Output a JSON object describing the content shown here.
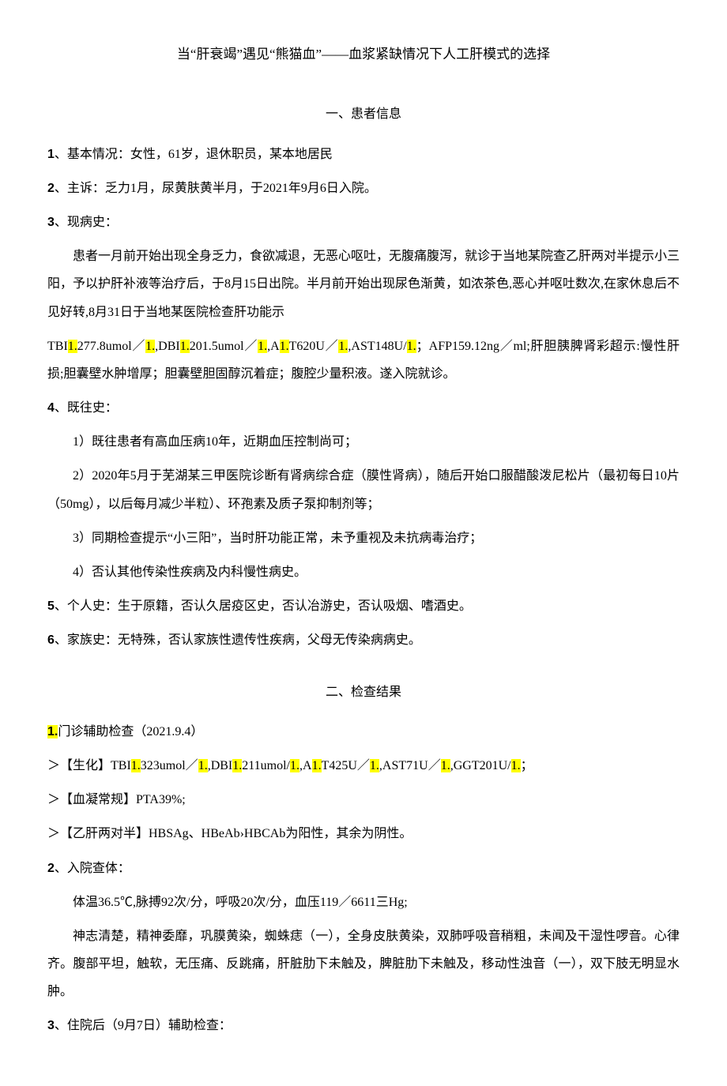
{
  "title": "当“肝衰竭”遇见“熊猫血”——血浆紧缺情况下人工肝模式的选择",
  "section1_heading": "一、患者信息",
  "item1_num": "1",
  "item1_text": "、基本情况：女性，61岁，退休职员，某本地居民",
  "item2_num": "2",
  "item2_text": "、主诉：乏力1月，尿黄肤黄半月，于2021年9月6日入院。",
  "item3_num": "3",
  "item3_text": "、现病史：",
  "history_p1a": "患者一月前开始出现全身乏力，食欲减退，无恶心呕吐，无腹痛腹泻，就诊于当地某院查乙肝两对半提示小三阳，予以护肝补液等治疗后，于8月15日出院。半月前开始出现尿色渐黄，如浓茶色,恶心并呕吐数次,在家休息后不见好转,8月31日于当地某医院检查肝功能示",
  "lab_tbi1_p": "TBI",
  "lab_hl1": "1.",
  "lab_tbi1_v": "277.8umol／",
  "lab_hl2": "1.",
  "lab_dbi1_p": ",DBI",
  "lab_hl3": "1.",
  "lab_dbi1_v": "201.5umol／",
  "lab_hl4": "1.",
  "lab_alt_p": ",A",
  "lab_hl5": "1.",
  "lab_alt_v": "T620U／",
  "lab_hl6": "1.",
  "lab_ast_p": ",AST148U/",
  "lab_hl7": "1.",
  "history_p1b": "；AFP159.12ng／ml;肝胆胰脾肾彩超示:慢性肝损;胆囊壁水肿增厚；胆囊壁胆固醇沉着症；腹腔少量积液。遂入院就诊。",
  "item4_num": "4",
  "item4_text": "、既往史：",
  "past1": "1）既往患者有高血压病10年，近期血压控制尚可；",
  "past2": "2）2020年5月于芜湖某三甲医院诊断有肾病综合症（膜性肾病），随后开始口服醋酸泼尼松片（最初每日10片（50mg），以后每月减少半粒）、环孢素及质子泵抑制剂等；",
  "past3": "3）同期检查提示“小三阳”，当时肝功能正常，未予重视及未抗病毒治疗；",
  "past4": "4）否认其他传染性疾病及内科慢性病史。",
  "item5_num": "5",
  "item5_text": "、个人史：生于原籍，否认久居疫区史，否认冶游史，否认吸烟、嗜酒史。",
  "item6_num": "6",
  "item6_text": "、家族史：无特殊，否认家族性遗传性疾病，父母无传染病病史。",
  "section2_heading": "二、检查结果",
  "exam1_num": "1.",
  "exam1_text": "门诊辅助检查（2021.9.4）",
  "bio_prefix": "＞【生化】TBI",
  "bio_hl1": "1.",
  "bio_v1": "323umol／",
  "bio_hl2": "1.",
  "bio_dbi": ",DBI",
  "bio_hl3": "1.",
  "bio_v2": "211umol/",
  "bio_hl4": "1.",
  "bio_alt": ",A",
  "bio_hl5": "1.",
  "bio_v3": "T425U／",
  "bio_hl6": "1.",
  "bio_ast": ",AST71U／",
  "bio_hl7": "1.",
  "bio_ggt": ",GGT201U/",
  "bio_hl8": "1.",
  "bio_end": "；",
  "coag": "＞【血凝常规】PTA39%;",
  "hbv": "＞【乙肝两对半】HBSAg、HBeAb›HBCAb为阳性，其余为阴性。",
  "exam2_num": "2",
  "exam2_text": "、入院查体：",
  "vitals": "体温36.5℃,脉搏92次/分，呼吸20次/分，血压119／6611三Hg;",
  "physical": "神志清楚，精神委靡，巩膜黄染，蜘蛛痣（一），全身皮肤黄染，双肺呼吸音稍粗，未闻及干湿性啰音。心律齐。腹部平坦，触软，无压痛、反跳痛，肝脏肋下未触及，脾脏肋下未触及，移动性浊音（一），双下肢无明显水肿。",
  "exam3_num": "3",
  "exam3_text": "、住院后（9月7日）辅助检查："
}
